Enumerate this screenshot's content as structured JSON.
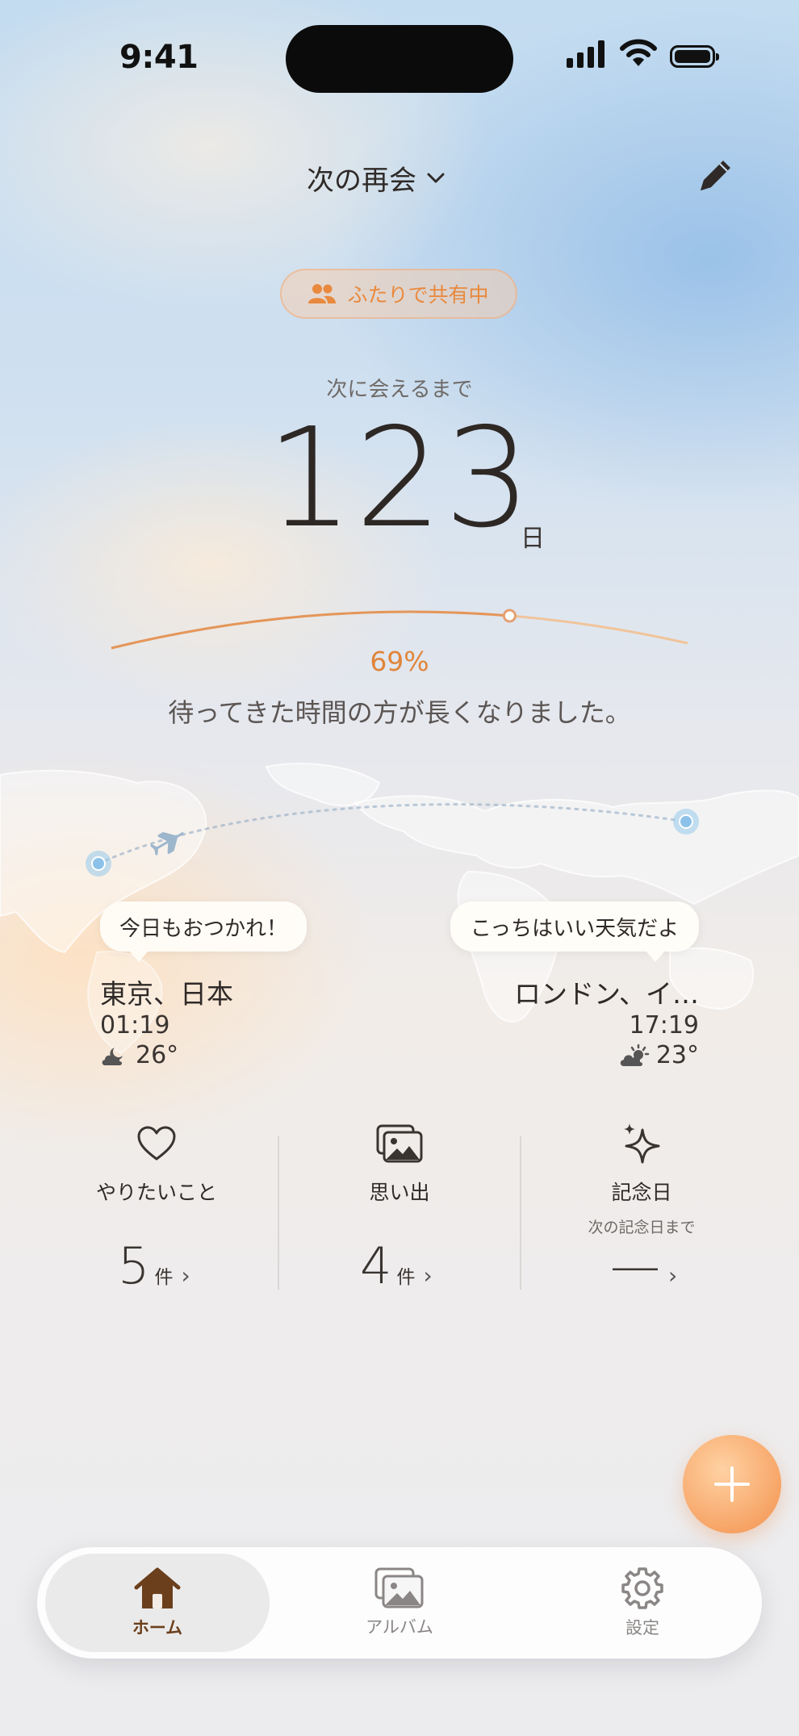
{
  "status_bar": {
    "time": "9:41"
  },
  "header": {
    "title": "次の再会"
  },
  "share_chip": {
    "label": "ふたりで共有中"
  },
  "countdown": {
    "label": "次に会えるまで",
    "days": "123",
    "unit": "日",
    "progress_text": "69%",
    "progress": 0.69,
    "message": "待ってきた時間の方が長くなりました。"
  },
  "cities": {
    "left": {
      "bubble": "今日もおつかれ！",
      "name": "東京、日本",
      "time": "01:19",
      "temp": "26°",
      "weather_icon": "moon-cloud-icon"
    },
    "right": {
      "bubble": "こっちはいい天気だよ",
      "name": "ロンドン、イ…",
      "time": "17:19",
      "temp": "23°",
      "weather_icon": "sun-cloud-icon"
    }
  },
  "stats": [
    {
      "label": "やりたいこと",
      "value": "5",
      "unit": "件",
      "icon": "heart-icon"
    },
    {
      "label": "思い出",
      "value": "4",
      "unit": "件",
      "icon": "photos-icon"
    },
    {
      "label": "記念日",
      "sublabel": "次の記念日まで",
      "value": "—",
      "icon": "sparkle-icon"
    }
  ],
  "chevron": "›",
  "fab": {
    "icon": "plus-icon"
  },
  "tabs": [
    {
      "label": "ホーム",
      "icon": "home-icon",
      "active": true
    },
    {
      "label": "アルバム",
      "icon": "photos-icon",
      "active": false
    },
    {
      "label": "設定",
      "icon": "gear-icon",
      "active": false
    }
  ],
  "colors": {
    "accent": "#e9893d",
    "text": "#2f2a28",
    "active_tab": "#6b3f1c"
  }
}
